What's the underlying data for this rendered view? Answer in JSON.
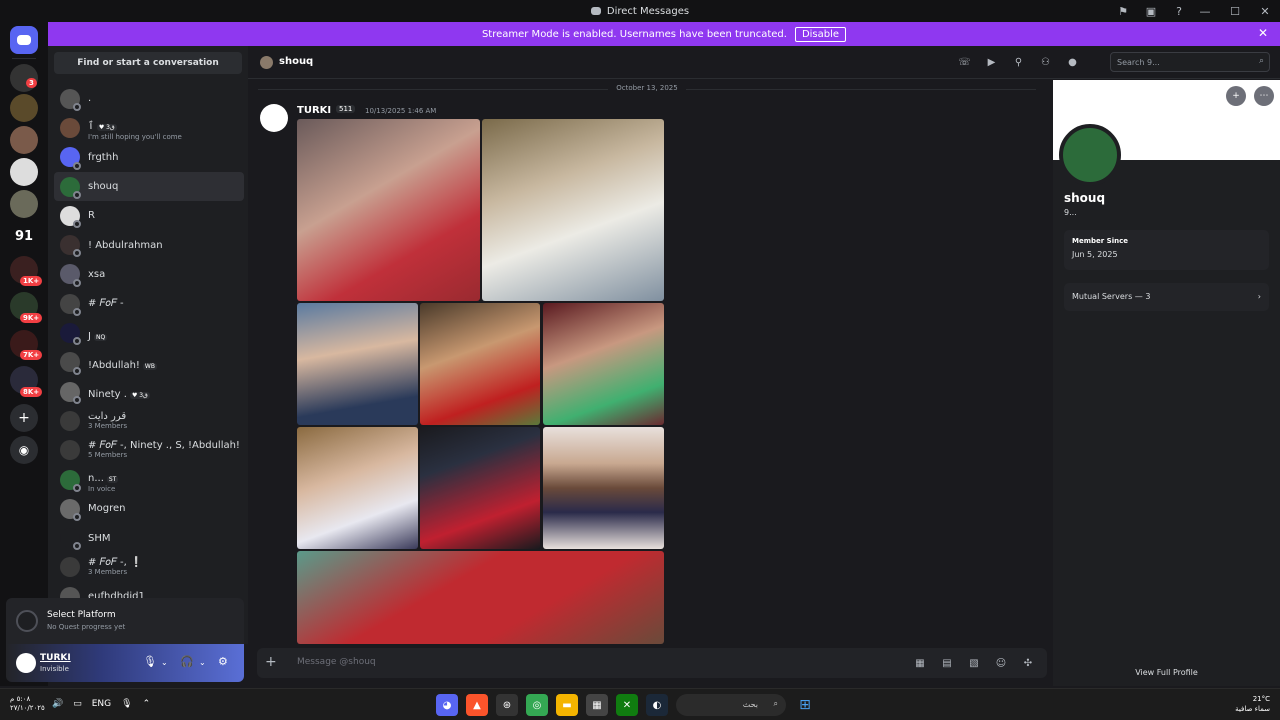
{
  "window": {
    "title": "Direct Messages"
  },
  "banner": {
    "text": "Streamer Mode is enabled. Usernames have been truncated.",
    "button": "Disable"
  },
  "guild_badges": [
    "3",
    "1K+",
    "9K+",
    "7K+",
    "8K+"
  ],
  "guild_label_91": "91",
  "dm_search": {
    "label": "Find or start a conversation"
  },
  "dms": [
    {
      "name": ".",
      "sub": ""
    },
    {
      "name": "ٱ",
      "tag": "♥ ق3",
      "sub": "I'm still hoping you'll come"
    },
    {
      "name": "frgthh",
      "sub": ""
    },
    {
      "name": "shouq",
      "sub": ""
    },
    {
      "name": "R",
      "sub": ""
    },
    {
      "name": "! Abdulrahman",
      "sub": ""
    },
    {
      "name": "xsa",
      "sub": ""
    },
    {
      "name": "# 𝐹𝑜𝐹 -",
      "sub": ""
    },
    {
      "name": "J",
      "tag": "NQ",
      "sub": ""
    },
    {
      "name": "!Abdullah!",
      "tag": "WB",
      "sub": ""
    },
    {
      "name": "Ninety .",
      "tag": "♥ ق3",
      "sub": ""
    },
    {
      "name": "قرر دايت",
      "sub": "3 Members"
    },
    {
      "name": "# 𝐹𝑜𝐹 -, Ninety ., S, !Abdullah!",
      "sub": "5 Members"
    },
    {
      "name": "n...",
      "tag": "ST",
      "sub": "In voice"
    },
    {
      "name": "Mogren",
      "sub": ""
    },
    {
      "name": "SHM",
      "sub": ""
    },
    {
      "name": "# 𝐹𝑜𝐹 -, ❕",
      "sub": "3 Members"
    },
    {
      "name": "eufhdhdid1",
      "sub": ""
    }
  ],
  "quest": {
    "title": "Select Platform",
    "sub": "No Quest progress yet"
  },
  "user": {
    "name": "TURKI",
    "status": "Invisible"
  },
  "chat_header": {
    "name": "shouq"
  },
  "search": {
    "placeholder": "Search 9..."
  },
  "date_divider": "October 13, 2025",
  "message": {
    "author": "TURKI",
    "tag": "511",
    "time": "10/13/2025 1:46 AM"
  },
  "composer": {
    "placeholder": "Message @shouq"
  },
  "profile": {
    "name": "shouq",
    "sub": "9...",
    "member_since_label": "Member Since",
    "member_since": "Jun 5, 2025",
    "mutual": "Mutual Servers — 3",
    "view_full": "View Full Profile"
  },
  "taskbar": {
    "lang": "ENG",
    "time": "٥:٠٨ م",
    "date": "٢٧/١٠/٢٠٢٥",
    "search": "بحث",
    "temp": "21°C",
    "weather": "سماء صافية"
  },
  "colors": {
    "accent": "#8f38f0",
    "bg": "#1a1a1e",
    "sidebar": "#1e1f22"
  }
}
